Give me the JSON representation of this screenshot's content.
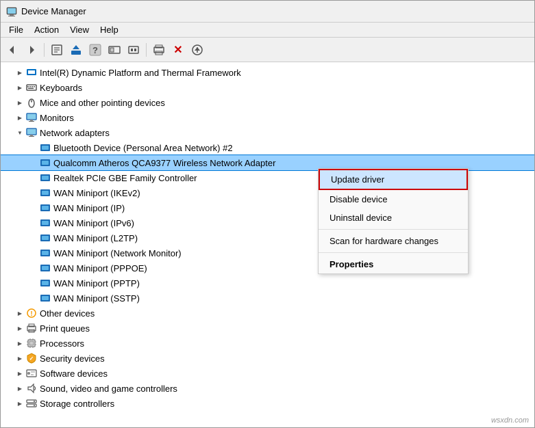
{
  "window": {
    "title": "Device Manager",
    "title_icon": "device-manager"
  },
  "menu": {
    "items": [
      "File",
      "Action",
      "View",
      "Help"
    ]
  },
  "toolbar": {
    "buttons": [
      {
        "name": "back",
        "label": "◀",
        "title": "Back"
      },
      {
        "name": "forward",
        "label": "▶",
        "title": "Forward"
      },
      {
        "name": "properties",
        "label": "🖹",
        "title": "Properties"
      },
      {
        "name": "update",
        "label": "⬆",
        "title": "Update Driver"
      },
      {
        "name": "help",
        "label": "❓",
        "title": "Help"
      },
      {
        "name": "toggle",
        "label": "⧉",
        "title": "Toggle"
      },
      {
        "name": "print",
        "label": "🖨",
        "title": "Print"
      },
      {
        "name": "delete",
        "label": "✖",
        "title": "Delete"
      },
      {
        "name": "download",
        "label": "⊕",
        "title": "Download"
      }
    ]
  },
  "tree": {
    "items": [
      {
        "id": "intel",
        "label": "Intel(R) Dynamic Platform and Thermal Framework",
        "indent": 1,
        "expanded": false,
        "icon": "cpu",
        "has_children": true
      },
      {
        "id": "keyboards",
        "label": "Keyboards",
        "indent": 1,
        "expanded": false,
        "icon": "keyboard",
        "has_children": true
      },
      {
        "id": "mice",
        "label": "Mice and other pointing devices",
        "indent": 1,
        "expanded": false,
        "icon": "mouse",
        "has_children": true
      },
      {
        "id": "monitors",
        "label": "Monitors",
        "indent": 1,
        "expanded": false,
        "icon": "monitor",
        "has_children": true
      },
      {
        "id": "network",
        "label": "Network adapters",
        "indent": 1,
        "expanded": true,
        "icon": "network",
        "has_children": true
      },
      {
        "id": "bluetooth",
        "label": "Bluetooth Device (Personal Area Network) #2",
        "indent": 2,
        "expanded": false,
        "icon": "network-card",
        "has_children": false
      },
      {
        "id": "qualcomm",
        "label": "Qualcomm Atheros QCA9377 Wireless Network Adapter",
        "indent": 2,
        "expanded": false,
        "icon": "network-card",
        "has_children": false,
        "selected": true
      },
      {
        "id": "realtek",
        "label": "Realtek PCIe GBE Family Controller",
        "indent": 2,
        "expanded": false,
        "icon": "network-card",
        "has_children": false
      },
      {
        "id": "wan-ikev2",
        "label": "WAN Miniport (IKEv2)",
        "indent": 2,
        "expanded": false,
        "icon": "network-card",
        "has_children": false
      },
      {
        "id": "wan-ip",
        "label": "WAN Miniport (IP)",
        "indent": 2,
        "expanded": false,
        "icon": "network-card",
        "has_children": false
      },
      {
        "id": "wan-ipv6",
        "label": "WAN Miniport (IPv6)",
        "indent": 2,
        "expanded": false,
        "icon": "network-card",
        "has_children": false
      },
      {
        "id": "wan-l2tp",
        "label": "WAN Miniport (L2TP)",
        "indent": 2,
        "expanded": false,
        "icon": "network-card",
        "has_children": false
      },
      {
        "id": "wan-netmon",
        "label": "WAN Miniport (Network Monitor)",
        "indent": 2,
        "expanded": false,
        "icon": "network-card",
        "has_children": false
      },
      {
        "id": "wan-pppoe",
        "label": "WAN Miniport (PPPOE)",
        "indent": 2,
        "expanded": false,
        "icon": "network-card",
        "has_children": false
      },
      {
        "id": "wan-pptp",
        "label": "WAN Miniport (PPTP)",
        "indent": 2,
        "expanded": false,
        "icon": "network-card",
        "has_children": false
      },
      {
        "id": "wan-sstp",
        "label": "WAN Miniport (SSTP)",
        "indent": 2,
        "expanded": false,
        "icon": "network-card",
        "has_children": false
      },
      {
        "id": "other",
        "label": "Other devices",
        "indent": 1,
        "expanded": false,
        "icon": "other",
        "has_children": true
      },
      {
        "id": "print",
        "label": "Print queues",
        "indent": 1,
        "expanded": false,
        "icon": "printer",
        "has_children": true
      },
      {
        "id": "processors",
        "label": "Processors",
        "indent": 1,
        "expanded": false,
        "icon": "cpu2",
        "has_children": true
      },
      {
        "id": "security",
        "label": "Security devices",
        "indent": 1,
        "expanded": false,
        "icon": "security",
        "has_children": true
      },
      {
        "id": "software",
        "label": "Software devices",
        "indent": 1,
        "expanded": false,
        "icon": "software",
        "has_children": true
      },
      {
        "id": "sound",
        "label": "Sound, video and game controllers",
        "indent": 1,
        "expanded": false,
        "icon": "sound",
        "has_children": true
      },
      {
        "id": "storage",
        "label": "Storage controllers",
        "indent": 1,
        "expanded": false,
        "icon": "storage",
        "has_children": true
      }
    ]
  },
  "context_menu": {
    "items": [
      {
        "id": "update",
        "label": "Update driver",
        "active": true,
        "bold": false
      },
      {
        "id": "disable",
        "label": "Disable device",
        "active": false,
        "bold": false
      },
      {
        "id": "uninstall",
        "label": "Uninstall device",
        "active": false,
        "bold": false
      },
      {
        "divider": true
      },
      {
        "id": "scan",
        "label": "Scan for hardware changes",
        "active": false,
        "bold": false
      },
      {
        "divider": true
      },
      {
        "id": "properties",
        "label": "Properties",
        "active": false,
        "bold": true
      }
    ]
  },
  "watermark": "wsxdn.com"
}
